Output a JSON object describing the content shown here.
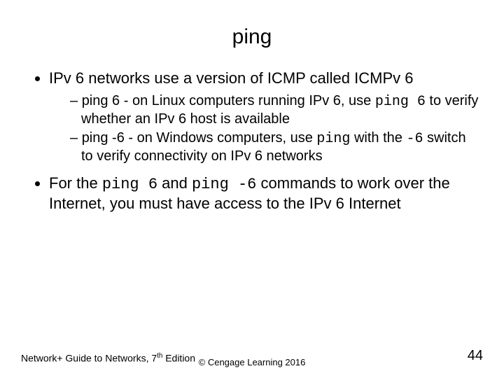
{
  "title": "ping",
  "bullets": {
    "b1": "IPv 6 networks use a version of ICMP called ICMPv 6",
    "b1_sub1_prefix": "ping 6 - on Linux computers running IPv 6, use ",
    "b1_sub1_code": "ping 6",
    "b1_sub1_suffix": " to verify whether an IPv 6 host is available",
    "b1_sub2_prefix": "ping -6 - on Windows computers, use ",
    "b1_sub2_code1": "ping",
    "b1_sub2_mid": " with the ",
    "b1_sub2_code2": "-6",
    "b1_sub2_suffix": " switch to verify connectivity on IPv 6 networks",
    "b2_prefix": "For the ",
    "b2_code1": "ping 6",
    "b2_mid1": " and ",
    "b2_code2": "ping -6",
    "b2_suffix": " commands to work over the Internet, you must have access to the IPv 6 Internet"
  },
  "footer": {
    "left_prefix": "Network+ Guide to Networks, 7",
    "left_sup": "th",
    "left_suffix": " Edition",
    "center": "© Cengage Learning  2016",
    "right": "44"
  }
}
